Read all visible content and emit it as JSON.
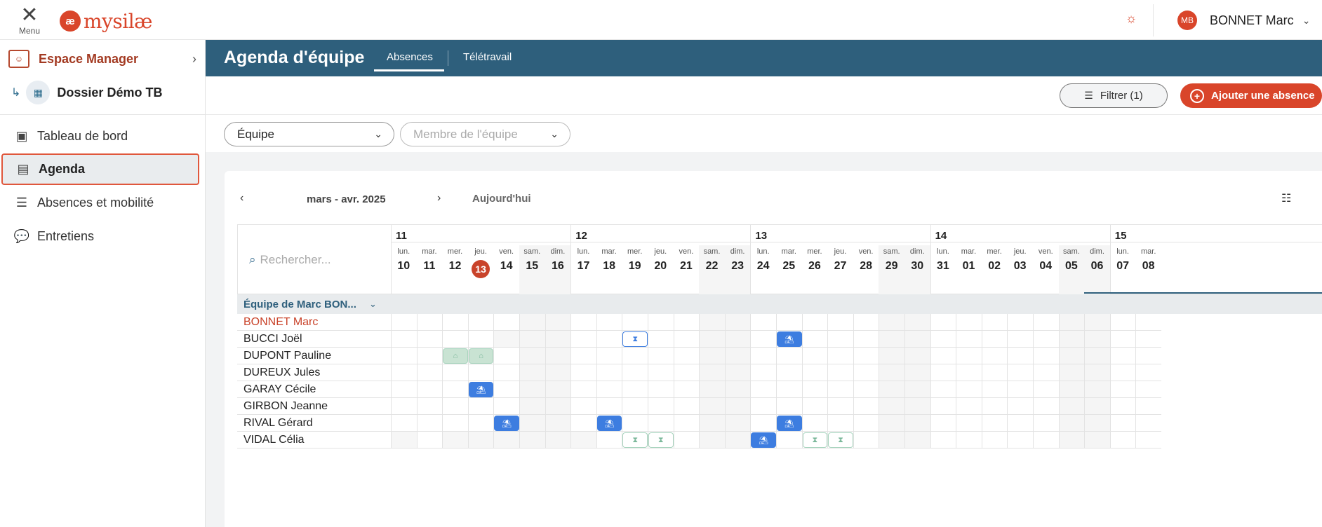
{
  "topbar": {
    "menu_icon": "close-icon",
    "menu_label": "Menu",
    "logo_mark": "æ",
    "logo_text": "mysilæ",
    "theme_icon": "sun-icon",
    "user_initials": "MB",
    "user_name": "BONNET Marc",
    "user_chevron": "chevron-down-icon"
  },
  "sidebar": {
    "espace": "Espace Manager",
    "dossier": "Dossier Démo TB",
    "items": [
      {
        "label": "Tableau de bord",
        "icon": "dashboard-icon"
      },
      {
        "label": "Agenda",
        "icon": "calendar-icon",
        "active": true
      },
      {
        "label": "Absences et mobilité",
        "icon": "list-icon"
      },
      {
        "label": "Entretiens",
        "icon": "chat-icon"
      }
    ]
  },
  "header": {
    "title": "Agenda d'équipe",
    "tabs": [
      {
        "label": "Absences",
        "active": true
      },
      {
        "label": "Télétravail"
      }
    ]
  },
  "actions": {
    "filter_label": "Filtrer (1)",
    "add_label": "Ajouter une absence"
  },
  "filters": {
    "equipe_value": "Équipe",
    "membre_placeholder": "Membre de l'équipe"
  },
  "calendar": {
    "period": "mars - avr. 2025",
    "today_label": "Aujourd'hui",
    "search_placeholder": "Rechercher...",
    "weeks": [
      {
        "label": "11",
        "start": 0
      },
      {
        "label": "12",
        "start": 7
      },
      {
        "label": "13",
        "start": 14
      },
      {
        "label": "14",
        "start": 21
      },
      {
        "label": "15",
        "start": 28
      }
    ],
    "days": [
      {
        "dw": "lun.",
        "dn": "10"
      },
      {
        "dw": "mar.",
        "dn": "11"
      },
      {
        "dw": "mer.",
        "dn": "12"
      },
      {
        "dw": "jeu.",
        "dn": "13",
        "today": true
      },
      {
        "dw": "ven.",
        "dn": "14"
      },
      {
        "dw": "sam.",
        "dn": "15",
        "we": true
      },
      {
        "dw": "dim.",
        "dn": "16",
        "we": true
      },
      {
        "dw": "lun.",
        "dn": "17"
      },
      {
        "dw": "mar.",
        "dn": "18"
      },
      {
        "dw": "mer.",
        "dn": "19"
      },
      {
        "dw": "jeu.",
        "dn": "20"
      },
      {
        "dw": "ven.",
        "dn": "21"
      },
      {
        "dw": "sam.",
        "dn": "22",
        "we": true
      },
      {
        "dw": "dim.",
        "dn": "23",
        "we": true
      },
      {
        "dw": "lun.",
        "dn": "24"
      },
      {
        "dw": "mar.",
        "dn": "25"
      },
      {
        "dw": "mer.",
        "dn": "26"
      },
      {
        "dw": "jeu.",
        "dn": "27"
      },
      {
        "dw": "ven.",
        "dn": "28"
      },
      {
        "dw": "sam.",
        "dn": "29",
        "we": true
      },
      {
        "dw": "dim.",
        "dn": "30",
        "we": true
      },
      {
        "dw": "lun.",
        "dn": "31"
      },
      {
        "dw": "mar.",
        "dn": "01"
      },
      {
        "dw": "mer.",
        "dn": "02"
      },
      {
        "dw": "jeu.",
        "dn": "03"
      },
      {
        "dw": "ven.",
        "dn": "04"
      },
      {
        "dw": "sam.",
        "dn": "05",
        "we": true
      },
      {
        "dw": "dim.",
        "dn": "06",
        "we": true
      },
      {
        "dw": "lun.",
        "dn": "07"
      },
      {
        "dw": "mar.",
        "dn": "08"
      }
    ],
    "team_label": "Équipe de Marc BON...",
    "employees": [
      {
        "name": "BONNET Marc",
        "me": true,
        "absences": []
      },
      {
        "name": "BUCCI Joël",
        "absences": [
          {
            "day": 9,
            "kind": "pending"
          },
          {
            "day": 15,
            "kind": "conge"
          }
        ]
      },
      {
        "name": "DUPONT Pauline",
        "absences": [
          {
            "day": 2,
            "kind": "tele"
          },
          {
            "day": 3,
            "kind": "tele"
          }
        ]
      },
      {
        "name": "DUREUX Jules",
        "absences": []
      },
      {
        "name": "GARAY Cécile",
        "absences": [
          {
            "day": 3,
            "kind": "conge"
          }
        ]
      },
      {
        "name": "GIRBON Jeanne",
        "absences": []
      },
      {
        "name": "RIVAL Gérard",
        "absences": [
          {
            "day": 4,
            "kind": "conge"
          },
          {
            "day": 8,
            "kind": "conge"
          },
          {
            "day": 15,
            "kind": "conge"
          }
        ]
      },
      {
        "name": "VIDAL Célia",
        "absences": [
          {
            "day": 9,
            "kind": "pending light"
          },
          {
            "day": 10,
            "kind": "pending light"
          },
          {
            "day": 14,
            "kind": "conge"
          },
          {
            "day": 16,
            "kind": "pending light"
          },
          {
            "day": 17,
            "kind": "pending light"
          }
        ]
      }
    ],
    "shaded": {
      "BUCCI Joël": [
        4
      ],
      "VIDAL Célia": [
        0,
        2,
        3,
        4,
        7
      ]
    },
    "icons": {
      "conge": "umbrella-icon",
      "pending": "hourglass-icon",
      "tele": "home-icon"
    }
  }
}
